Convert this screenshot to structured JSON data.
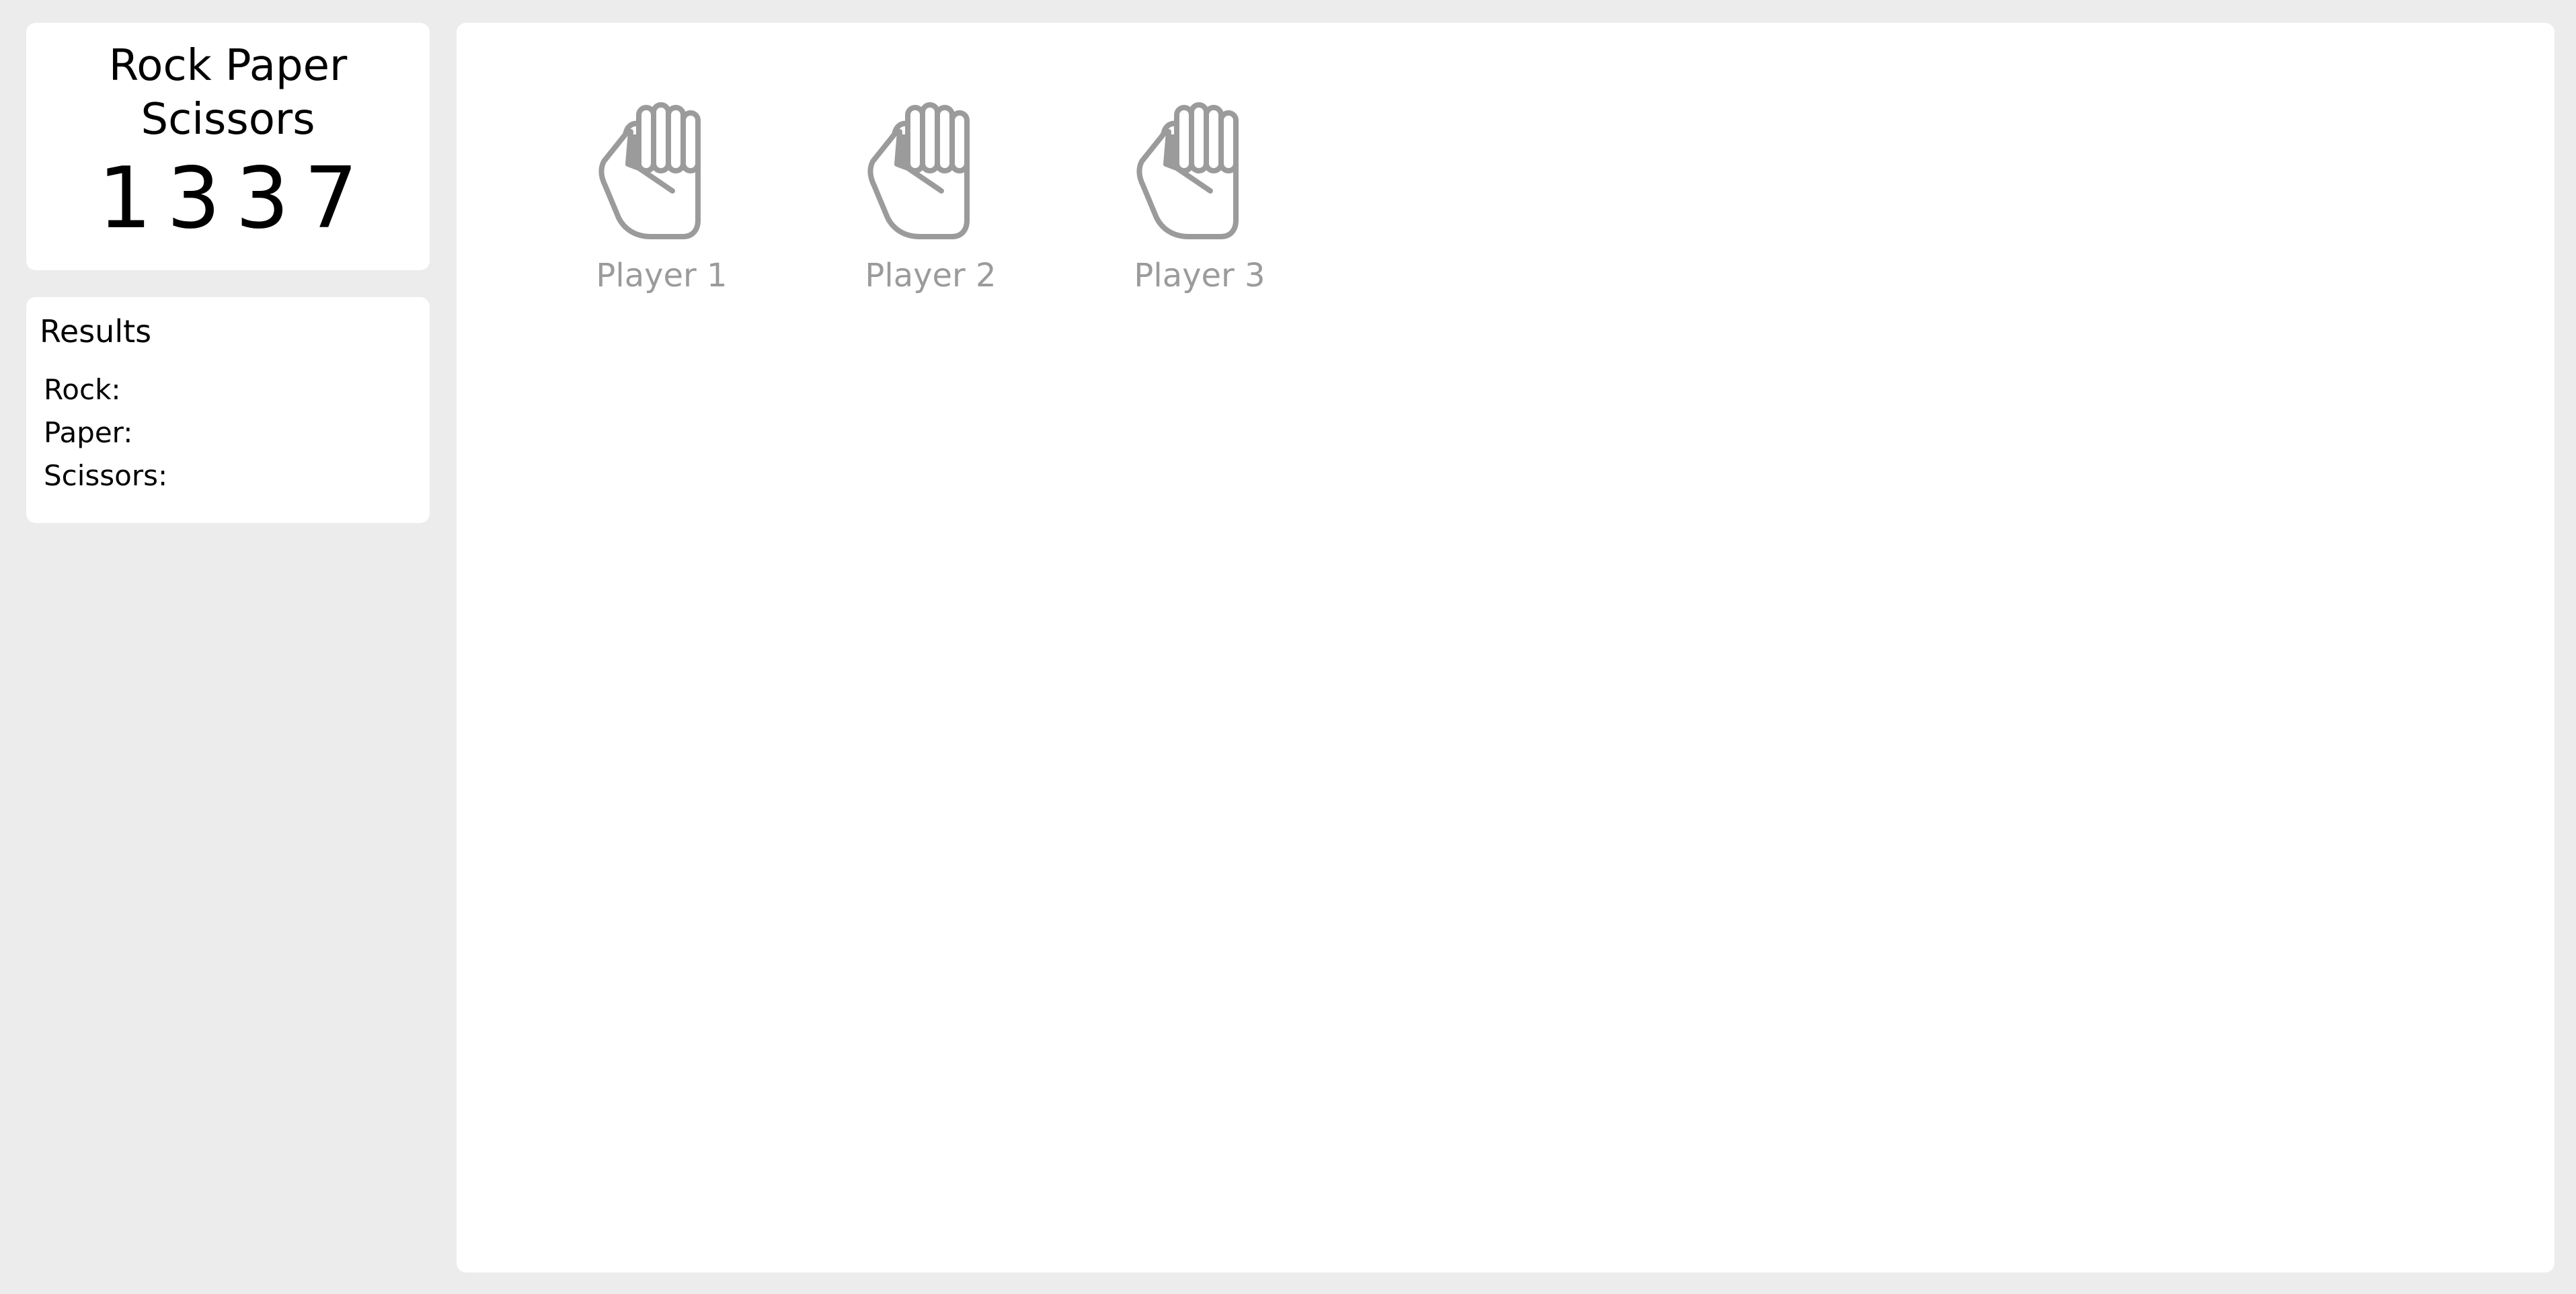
{
  "app": {
    "title": "Rock Paper Scissors",
    "counter": "1337"
  },
  "results": {
    "heading": "Results",
    "items": [
      {
        "label": "Rock:"
      },
      {
        "label": "Paper:"
      },
      {
        "label": "Scissors:"
      }
    ]
  },
  "players": [
    {
      "label": "Player 1",
      "icon": "fist-icon"
    },
    {
      "label": "Player 2",
      "icon": "fist-icon"
    },
    {
      "label": "Player 3",
      "icon": "fist-icon"
    }
  ],
  "colors": {
    "background": "#ececec",
    "card": "#ffffff",
    "muted": "#9b9b9b",
    "text": "#000000"
  }
}
